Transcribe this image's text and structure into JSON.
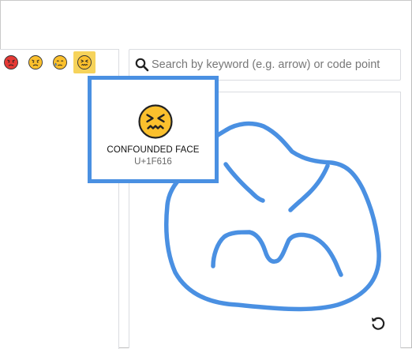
{
  "search": {
    "placeholder": "Search by keyword (e.g. arrow) or code point",
    "value": ""
  },
  "emoji_row": [
    {
      "name": "pouting face",
      "icon": "pouting-face-icon",
      "selected": false
    },
    {
      "name": "angry face",
      "icon": "angry-face-icon",
      "selected": false
    },
    {
      "name": "sad but relieved face",
      "icon": "sad-relieved-face-icon",
      "selected": false
    },
    {
      "name": "confounded face",
      "icon": "confounded-face-icon",
      "selected": true
    }
  ],
  "tooltip": {
    "name": "CONFOUNDED FACE",
    "code": "U+1F616",
    "icon": "confounded-face-icon"
  },
  "canvas": {
    "stroke_color": "#4a90e2",
    "reset_icon": "refresh-icon"
  },
  "colors": {
    "highlight": "#f6d35b",
    "accent_border": "#4a90e2"
  }
}
